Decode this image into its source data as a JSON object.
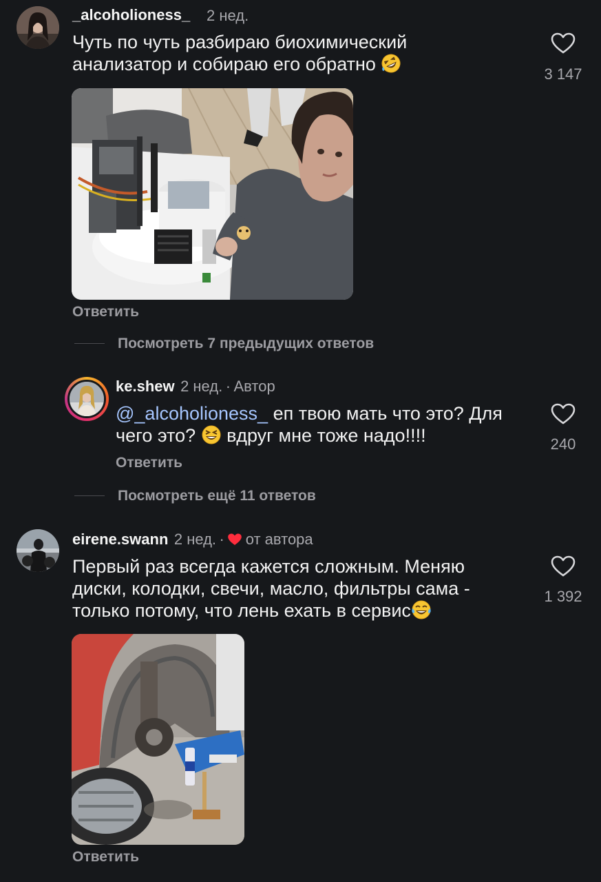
{
  "comments": [
    {
      "username": "_alcoholioness_",
      "time": "2 нед.",
      "text_line1": "Чуть по чуть разбираю биохимический",
      "text_line2": "анализатор и собираю его обратно",
      "likes": "3 147",
      "reply_label": "Ответить",
      "emoji": "rofl-emoji"
    },
    {
      "username": "ke.shew",
      "time": "2 нед.",
      "separator": "·",
      "author_badge": "Автор",
      "mention": "@_alcoholioness_",
      "text_line1": " еп твою мать что это? Для",
      "text_line2a": "чего это?",
      "text_line2b": "вдруг мне тоже надо!!!!",
      "likes": "240",
      "reply_label": "Ответить",
      "emoji": "grinning-squint-emoji"
    },
    {
      "username": "eirene.swann",
      "time": "2 нед.",
      "separator": "·",
      "from_author": "от автора",
      "text_line1": "Первый раз всегда кажется сложным. Меняю",
      "text_line2": "диски, колодки, свечи, масло, фильтры сама -",
      "text_line3": "только потому, что лень ехать в сервис",
      "likes": "1 392",
      "reply_label": "Ответить",
      "emoji": "tears-of-joy-emoji"
    }
  ],
  "threads": {
    "view_previous": "Посмотреть 7 предыдущих ответов",
    "view_more": "Посмотреть ещё 11 ответов"
  },
  "colors": {
    "background": "#16181b",
    "heart_red": "#ff2d3d",
    "mention_blue": "#a6c6ff"
  }
}
